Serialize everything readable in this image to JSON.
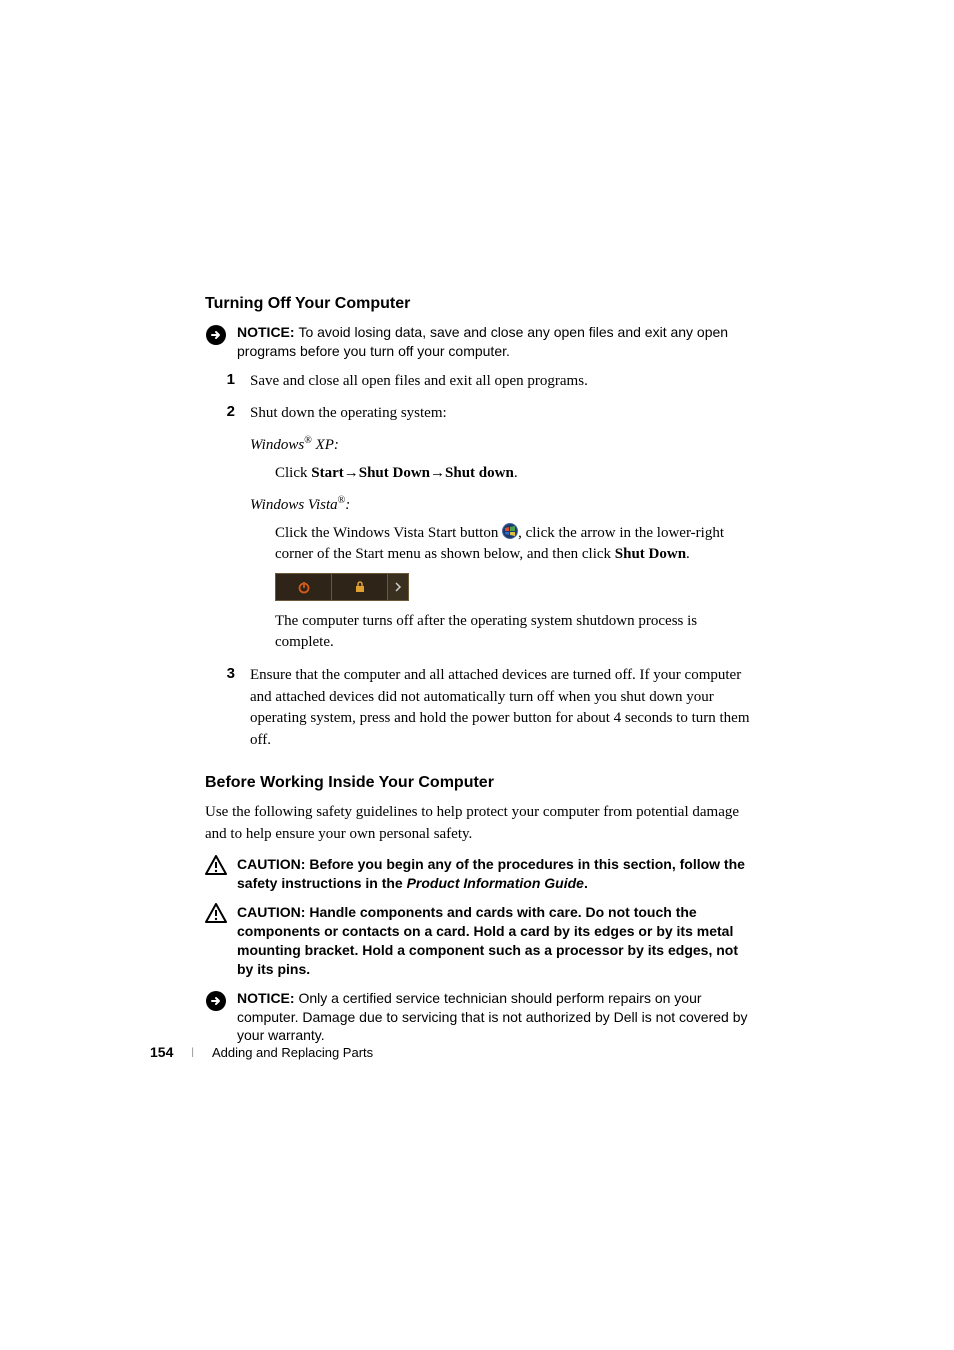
{
  "heading1": "Turning Off Your Computer",
  "notice1_label": "NOTICE: ",
  "notice1_text": "To avoid losing data, save and close any open files and exit any open programs before you turn off your computer.",
  "step1_num": "1",
  "step1_text": "Save and close all open files and exit all open programs.",
  "step2_num": "2",
  "step2_text": "Shut down the operating system:",
  "winxp_label_a": "Windows",
  "winxp_reg": "®",
  "winxp_label_b": " XP:",
  "winxp_instr_a": "Click ",
  "winxp_instr_b": "Start",
  "winxp_instr_c": "→",
  "winxp_instr_d": "Shut Down",
  "winxp_instr_e": "→",
  "winxp_instr_f": "Shut down",
  "winxp_instr_g": ".",
  "vista_label_a": "Windows Vista",
  "vista_reg": "®",
  "vista_label_b": ":",
  "vista_instr_a": "Click the Windows Vista Start button ",
  "vista_instr_b": ", click the arrow in the lower-right corner of the Start menu as shown below, and then click ",
  "vista_instr_c": "Shut Down",
  "vista_instr_d": ".",
  "vista_after": "The computer turns off after the operating system shutdown process is complete.",
  "step3_num": "3",
  "step3_text": "Ensure that the computer and all attached devices are turned off. If your computer and attached devices did not automatically turn off when you shut down your operating system, press and hold the power button for about 4 seconds to turn them off.",
  "heading2": "Before Working Inside Your Computer",
  "para2": "Use the following safety guidelines to help protect your computer from potential damage and to help ensure your own personal safety.",
  "caution1_label": "CAUTION: ",
  "caution1_a": "Before you begin any of the procedures in this section, follow the safety instructions in the ",
  "caution1_b": "Product Information Guide",
  "caution1_c": ".",
  "caution2_label": "CAUTION: ",
  "caution2_text": "Handle components and cards with care. Do not touch the components or contacts on a card. Hold a card by its edges or by its metal mounting bracket. Hold a component such as a processor by its edges, not by its pins.",
  "notice2_label": "NOTICE: ",
  "notice2_text": "Only a certified service technician should perform repairs on your computer. Damage due to servicing that is not authorized by Dell is not covered by your warranty.",
  "page_num": "154",
  "footer_text": "Adding and Replacing Parts"
}
